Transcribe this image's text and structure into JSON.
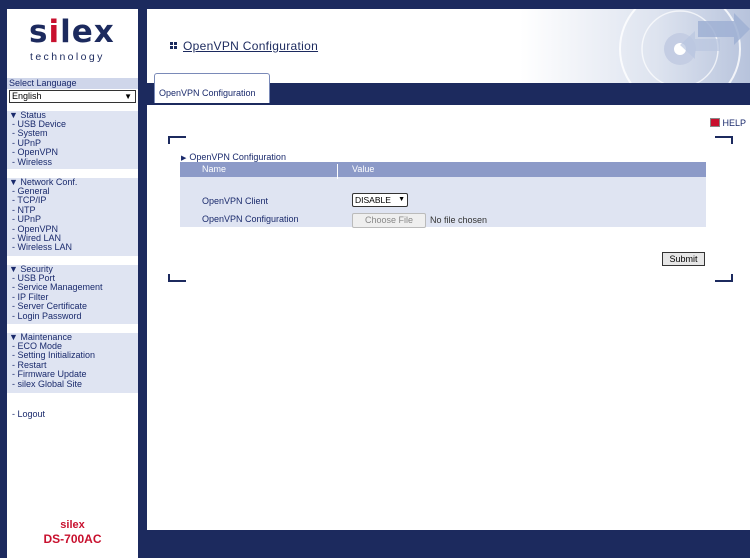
{
  "logo": {
    "brand_prefix": "s",
    "brand_i": "i",
    "brand_suffix": "lex",
    "subtitle": "technology"
  },
  "language": {
    "label": "Select Language",
    "selected": "English"
  },
  "menu": {
    "status": {
      "title": "▼ Status",
      "items": [
        "- USB Device",
        "- System",
        "- UPnP",
        "- OpenVPN",
        "- Wireless"
      ]
    },
    "network": {
      "title": "▼ Network Conf.",
      "items": [
        "- General",
        "- TCP/IP",
        "- NTP",
        "- UPnP",
        "- OpenVPN",
        "- Wired LAN",
        "- Wireless LAN"
      ]
    },
    "security": {
      "title": "▼ Security",
      "items": [
        "- USB Port",
        "- Service Management",
        "- IP Filter",
        "- Server Certificate",
        "- Login Password"
      ]
    },
    "maintenance": {
      "title": "▼ Maintenance",
      "items": [
        "- ECO Mode",
        "- Setting Initialization",
        "- Restart",
        "- Firmware Update",
        "- silex Global Site"
      ]
    },
    "logout": "- Logout"
  },
  "model": {
    "line1": "silex",
    "line2": "DS-700AC"
  },
  "header": {
    "title": "OpenVPN Configuration"
  },
  "tab": {
    "label": "OpenVPN Configuration"
  },
  "help": {
    "label": "HELP"
  },
  "section": {
    "title": "OpenVPN Configuration"
  },
  "table": {
    "col_name": "Name",
    "col_value": "Value",
    "rows": [
      {
        "name": "OpenVPN Client",
        "value": "DISABLE"
      },
      {
        "name": "OpenVPN Configuration",
        "button": "Choose File",
        "note": "No file chosen"
      }
    ]
  },
  "submit": {
    "label": "Submit"
  },
  "colors": {
    "navy": "#1c2a5e",
    "accent_red": "#c8102e",
    "menu_bg": "#dfe4f2",
    "table_header": "#8c9ac8"
  }
}
